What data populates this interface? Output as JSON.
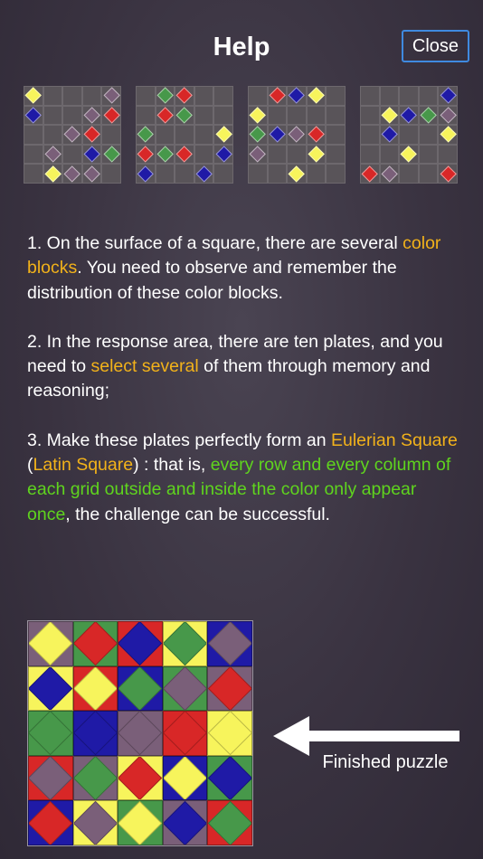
{
  "header": {
    "title": "Help",
    "close_label": "Close"
  },
  "colors": {
    "yellow": "#f7f45c",
    "red": "#d82727",
    "blue": "#1f1aa6",
    "green": "#47984a",
    "purple": "#7a5f79",
    "empty": "#595459"
  },
  "thumbnails": [
    {
      "marks": [
        [
          "y",
          0,
          0
        ],
        [
          "p",
          4,
          0
        ],
        [
          "b",
          0,
          1
        ],
        [
          "p",
          3,
          1
        ],
        [
          "r",
          4,
          1
        ],
        [
          "p",
          2,
          2
        ],
        [
          "r",
          3,
          2
        ],
        [
          "p",
          1,
          3
        ],
        [
          "b",
          3,
          3
        ],
        [
          "g",
          4,
          3
        ],
        [
          "g",
          1,
          4
        ],
        [
          "y",
          1,
          4
        ],
        [
          "p",
          2,
          4
        ],
        [
          "p",
          3,
          4
        ]
      ]
    },
    {
      "marks": [
        [
          "g",
          1,
          0
        ],
        [
          "r",
          2,
          0
        ],
        [
          "r",
          1,
          1
        ],
        [
          "g",
          2,
          1
        ],
        [
          "g",
          0,
          2
        ],
        [
          "y",
          4,
          2
        ],
        [
          "r",
          0,
          3
        ],
        [
          "g",
          1,
          3
        ],
        [
          "r",
          2,
          3
        ],
        [
          "b",
          4,
          3
        ],
        [
          "b",
          0,
          4
        ],
        [
          "b",
          3,
          4
        ]
      ]
    },
    {
      "marks": [
        [
          "r",
          1,
          0
        ],
        [
          "b",
          2,
          0
        ],
        [
          "y",
          3,
          0
        ],
        [
          "y",
          0,
          1
        ],
        [
          "g",
          0,
          2
        ],
        [
          "b",
          1,
          2
        ],
        [
          "p",
          2,
          2
        ],
        [
          "r",
          3,
          2
        ],
        [
          "p",
          0,
          3
        ],
        [
          "y",
          3,
          3
        ],
        [
          "y",
          2,
          4
        ]
      ]
    },
    {
      "marks": [
        [
          "b",
          4,
          0
        ],
        [
          "y",
          1,
          1
        ],
        [
          "b",
          2,
          1
        ],
        [
          "g",
          3,
          1
        ],
        [
          "p",
          4,
          1
        ],
        [
          "b",
          1,
          2
        ],
        [
          "y",
          4,
          2
        ],
        [
          "y",
          2,
          3
        ],
        [
          "r",
          0,
          4
        ],
        [
          "p",
          1,
          4
        ],
        [
          "r",
          4,
          4
        ]
      ]
    }
  ],
  "instructions": {
    "p1_a": "1. On the surface of a square, there are several ",
    "p1_hl": "color blocks",
    "p1_b": ". You need to observe and remember the distribution of these color blocks.",
    "p2_a": "2. In the response area, there are ten plates, and you need to ",
    "p2_hl": "select several",
    "p2_b": " of them through memory and reasoning;",
    "p3_a": "3. Make these plates perfectly form an ",
    "p3_hl1": "Eulerian Square",
    "p3_mid1": " (",
    "p3_hl2": "Latin Square",
    "p3_mid2": ") : that is, ",
    "p3_hl3": "every row and every column of each grid outside and inside the color only appear once",
    "p3_b": ", the challenge can be successful."
  },
  "finished": {
    "label": "Finished puzzle",
    "grid": [
      [
        [
          "p",
          "y"
        ],
        [
          "g",
          "r"
        ],
        [
          "r",
          "b"
        ],
        [
          "y",
          "g"
        ],
        [
          "b",
          "p"
        ]
      ],
      [
        [
          "y",
          "b"
        ],
        [
          "r",
          "y"
        ],
        [
          "b",
          "g"
        ],
        [
          "g",
          "p"
        ],
        [
          "p",
          "r"
        ]
      ],
      [
        [
          "g",
          "g"
        ],
        [
          "b",
          "b"
        ],
        [
          "p",
          "p"
        ],
        [
          "r",
          "r"
        ],
        [
          "y",
          "y"
        ]
      ],
      [
        [
          "r",
          "p"
        ],
        [
          "p",
          "g"
        ],
        [
          "y",
          "r"
        ],
        [
          "b",
          "y"
        ],
        [
          "g",
          "b"
        ]
      ],
      [
        [
          "b",
          "r"
        ],
        [
          "y",
          "p"
        ],
        [
          "g",
          "y"
        ],
        [
          "p",
          "b"
        ],
        [
          "r",
          "g"
        ]
      ]
    ]
  }
}
